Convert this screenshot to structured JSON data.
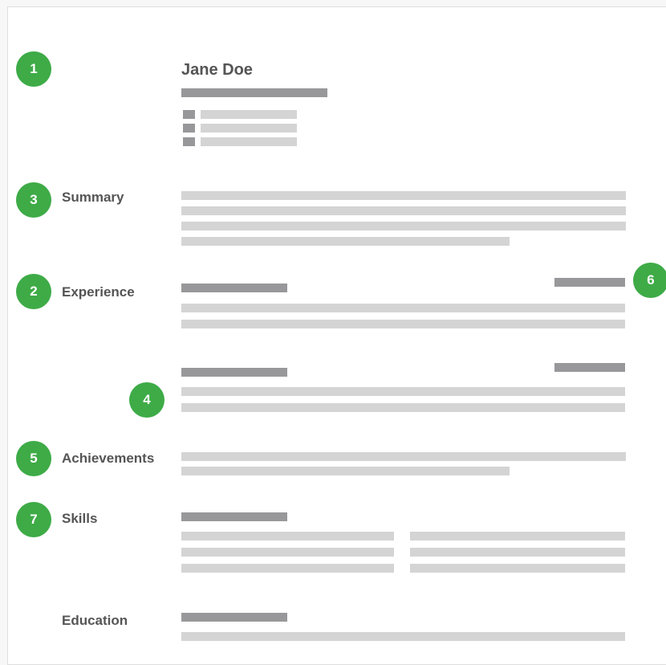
{
  "resume": {
    "name": "Jane Doe"
  },
  "sections": {
    "summary": "Summary",
    "experience": "Experience",
    "achievements": "Achievements",
    "skills": "Skills",
    "education": "Education"
  },
  "badges": [
    "1",
    "2",
    "3",
    "4",
    "5",
    "6",
    "7"
  ],
  "colors": {
    "badge": "#3eab47",
    "placeholder_dark": "#98989b",
    "placeholder_light": "#d4d4d4"
  }
}
